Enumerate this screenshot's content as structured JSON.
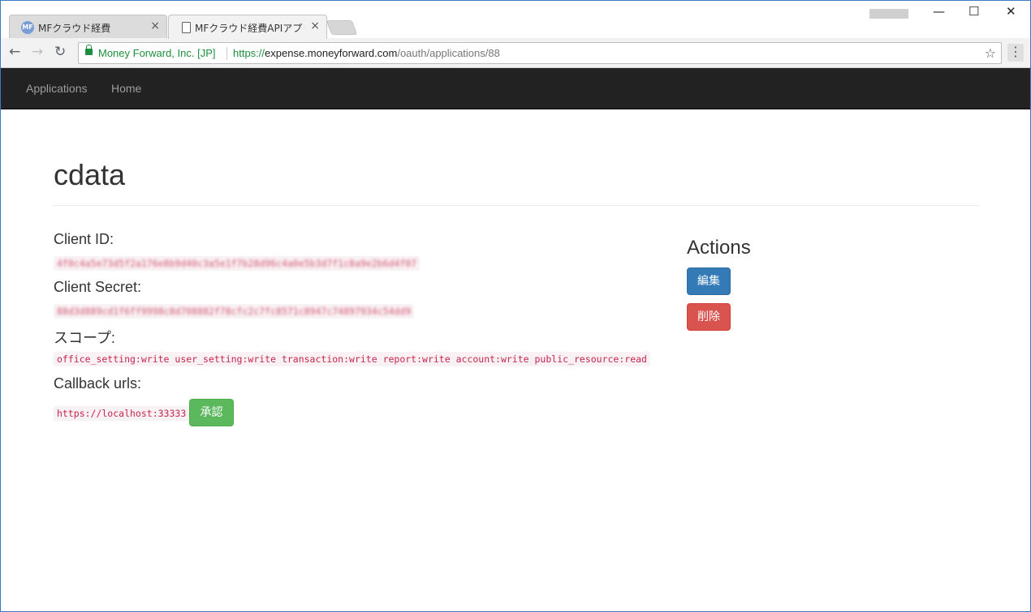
{
  "browser": {
    "tabs": [
      {
        "label": "MFクラウド経費",
        "favicon": "mf-logo-icon",
        "active": false
      },
      {
        "label": "MFクラウド経費APIアプリケ",
        "favicon": "document-icon",
        "active": true
      }
    ],
    "tab_close_glyph": "×",
    "window_controls": {
      "minimize": "—",
      "maximize": "☐",
      "close": "✕"
    },
    "security_label": "Money Forward, Inc. [JP]",
    "url": {
      "scheme": "https://",
      "host": "expense.moneyforward.com",
      "path": "/oauth/applications/88"
    },
    "nav": {
      "back": "←",
      "forward": "→",
      "reload": "↻",
      "bookmark": "☆",
      "menu": "⋮"
    }
  },
  "navbar": {
    "items": [
      {
        "label": "Applications"
      },
      {
        "label": "Home"
      }
    ]
  },
  "app": {
    "name": "cdata",
    "client_id_label": "Client ID:",
    "client_id_value": "4f0c4a5e73d5f2a176e8b9d40c3a5e1f7b28d96c4a0e5b3d7f1c8a9e2b6d4f07",
    "client_secret_label": "Client Secret:",
    "client_secret_value": "88d3d889cd1f6ff9998c8d708882f78cfc2c7fc8571c8947c74897934c54dd9",
    "scope_label": "スコープ:",
    "scope_value": "office_setting:write user_setting:write transaction:write report:write account:write public_resource:read",
    "callback_label": "Callback urls:",
    "callback_value": "https://localhost:33333",
    "authorize_button": "承認"
  },
  "actions": {
    "title": "Actions",
    "edit_button": "編集",
    "delete_button": "削除"
  },
  "colors": {
    "navbar_bg": "#222222",
    "primary": "#337ab7",
    "danger": "#d9534f",
    "success": "#5cb85c",
    "code_text": "#c7254e",
    "secure_green": "#1e8e3e"
  }
}
